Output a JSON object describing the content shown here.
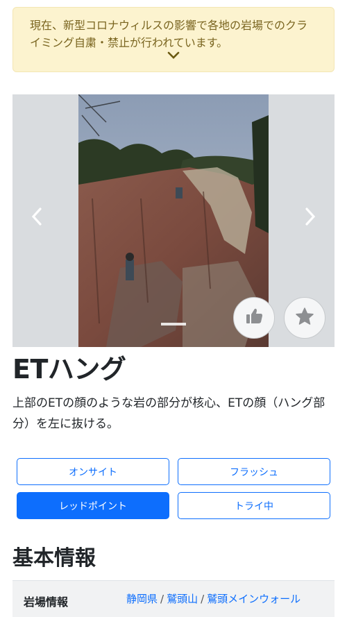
{
  "notice": {
    "text": "現在、新型コロナウィルスの影響で各地の岩場でのクライミング自粛・禁止が行われています。",
    "icon": "chevron-down-icon"
  },
  "carousel": {
    "prev_icon": "chevron-left-icon",
    "next_icon": "chevron-right-icon"
  },
  "actions": {
    "like_icon": "thumbs-up-icon",
    "favorite_icon": "star-icon"
  },
  "route": {
    "name": "ETハング",
    "description": "上部のETの顔のような岩の部分が核心、ETの顔（ハング部分）を左に抜ける。"
  },
  "ascent_buttons": [
    {
      "label": "オンサイト",
      "active": false
    },
    {
      "label": "フラッシュ",
      "active": false
    },
    {
      "label": "レッドポイント",
      "active": true
    },
    {
      "label": "トライ中",
      "active": false
    }
  ],
  "basic_info": {
    "title": "基本情報",
    "crag_label": "岩場情報",
    "breadcrumb": [
      "静岡県",
      "鷲頭山",
      "鷲頭メインウォール"
    ],
    "separator": "/"
  },
  "colors": {
    "accent": "#0d6efd",
    "notice_bg": "#fcf3cf",
    "notice_text": "#7a6520"
  }
}
